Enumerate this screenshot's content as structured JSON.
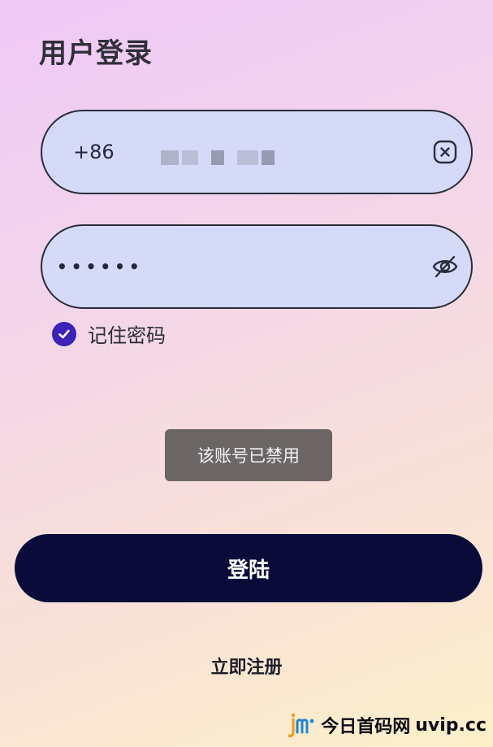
{
  "header": {
    "title": "用户登录"
  },
  "phone_field": {
    "prefix": "+86",
    "value_masked": true,
    "clear_icon": "clear-icon"
  },
  "password_field": {
    "value": "••••••",
    "visibility_icon": "eye-off-icon"
  },
  "remember": {
    "label": "记住密码",
    "checked": true
  },
  "toast": {
    "message": "该账号已禁用"
  },
  "actions": {
    "login_label": "登陆",
    "register_label": "立即注册"
  },
  "watermark": {
    "site_name": "今日首码网",
    "domain": "uvip.cc"
  },
  "colors": {
    "field_bg": "#d5daf8",
    "button_bg": "#0b0b3a",
    "checkbox": "#3b22b8",
    "toast_bg": "#6c6565"
  }
}
